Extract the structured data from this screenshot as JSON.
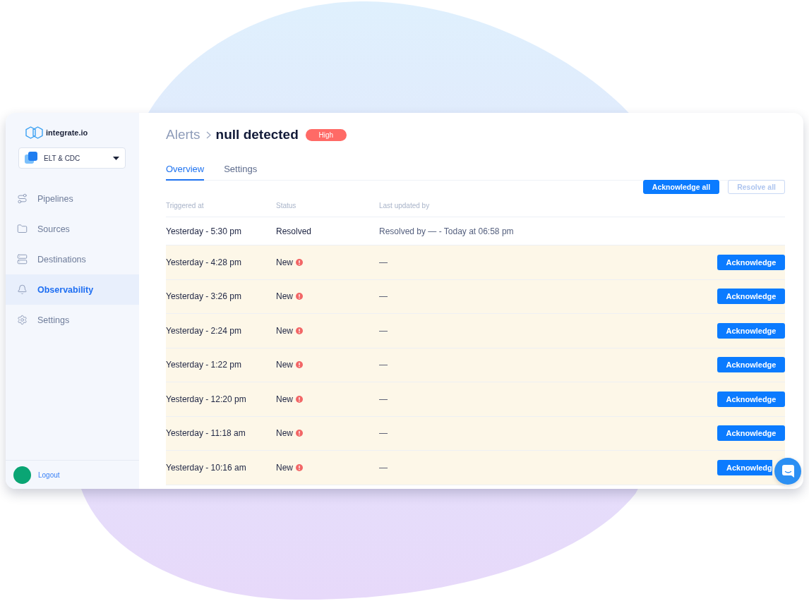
{
  "sidebar": {
    "logo": "integrate.io",
    "workspace": {
      "label": "ELT & CDC"
    },
    "nav": [
      {
        "label": "Pipelines",
        "selected": false
      },
      {
        "label": "Sources",
        "selected": false
      },
      {
        "label": "Destinations",
        "selected": false
      },
      {
        "label": "Observability",
        "selected": true
      },
      {
        "label": "Settings",
        "selected": false
      }
    ],
    "footer": {
      "logout": "Logout"
    }
  },
  "header": {
    "breadcrumb": "Alerts",
    "title": "null detected",
    "severity": "High"
  },
  "tabs": [
    {
      "label": "Overview",
      "selected": true
    },
    {
      "label": "Settings",
      "selected": false
    }
  ],
  "actions": [
    {
      "label": "Acknowledge all",
      "disabled": false
    },
    {
      "label": "Resolve all",
      "disabled": true
    }
  ],
  "table": {
    "columns": [
      "Triggered at",
      "Status",
      "Last updated by"
    ],
    "rows": [
      {
        "kind": "resolved",
        "triggered_at": "Yesterday - 5:30 pm",
        "status": "Resolved",
        "last_updated_by": "Resolved by — - Today at 06:58 pm"
      },
      {
        "kind": "new",
        "triggered_at": "Yesterday - 4:28 pm",
        "status": "New",
        "last_updated_by": "—",
        "action": "Acknowledge",
        "covered": false
      },
      {
        "kind": "new",
        "triggered_at": "Yesterday - 3:26 pm",
        "status": "New",
        "last_updated_by": "—",
        "action": "Acknowledge",
        "covered": false
      },
      {
        "kind": "new",
        "triggered_at": "Yesterday - 2:24 pm",
        "status": "New",
        "last_updated_by": "—",
        "action": "Acknowledge",
        "covered": false
      },
      {
        "kind": "new",
        "triggered_at": "Yesterday - 1:22 pm",
        "status": "New",
        "last_updated_by": "—",
        "action": "Acknowledge",
        "covered": false
      },
      {
        "kind": "new",
        "triggered_at": "Yesterday - 12:20 pm",
        "status": "New",
        "last_updated_by": "—",
        "action": "Acknowledge",
        "covered": false
      },
      {
        "kind": "new",
        "triggered_at": "Yesterday - 11:18 am",
        "status": "New",
        "last_updated_by": "—",
        "action": "Acknowledge",
        "covered": false
      },
      {
        "kind": "new",
        "triggered_at": "Yesterday - 10:16 am",
        "status": "New",
        "last_updated_by": "—",
        "action": "Acknowledg",
        "covered": true
      }
    ]
  }
}
